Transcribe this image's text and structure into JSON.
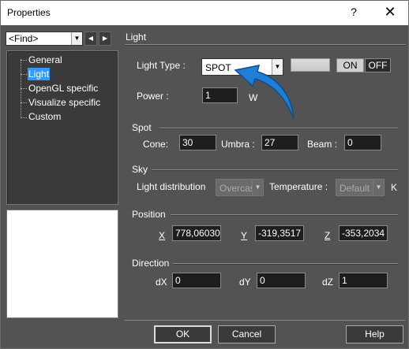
{
  "window": {
    "title": "Properties",
    "help_glyph": "?",
    "close_glyph": "✕"
  },
  "find": {
    "value": "<Find>"
  },
  "tree": {
    "items": [
      {
        "label": "General"
      },
      {
        "label": "Light"
      },
      {
        "label": "OpenGL specific"
      },
      {
        "label": "Visualize specific"
      },
      {
        "label": "Custom"
      }
    ],
    "selected": "Light"
  },
  "panel": {
    "header": "Light",
    "light_type": {
      "label": "Light Type :",
      "value": "SPOT"
    },
    "toggle": {
      "on": "ON",
      "off": "OFF"
    },
    "power": {
      "label": "Power :",
      "value": "1",
      "unit": "W"
    },
    "spot": {
      "title": "Spot",
      "cone_label": "Cone:",
      "cone": "30",
      "umbra_label": "Umbra :",
      "umbra": "27",
      "beam_label": "Beam :",
      "beam": "0"
    },
    "sky": {
      "title": "Sky",
      "distribution_label": "Light distribution",
      "distribution": "Overcas",
      "temperature_label": "Temperature :",
      "temperature": "Default",
      "temperature_unit": "K"
    },
    "position": {
      "title": "Position",
      "x_label": "X",
      "x": "778,06030",
      "y_label": "Y",
      "y": "-319,3517",
      "z_label": "Z",
      "z": "-353,2034"
    },
    "direction": {
      "title": "Direction",
      "dx_label": "dX",
      "dx": "0",
      "dy_label": "dY",
      "dy": "0",
      "dz_label": "dZ",
      "dz": "1"
    }
  },
  "buttons": {
    "ok": "OK",
    "cancel": "Cancel",
    "help": "Help"
  },
  "colors": {
    "panel_bg": "#535353",
    "selection": "#3399ff",
    "arrow": "#1f7fd6"
  }
}
